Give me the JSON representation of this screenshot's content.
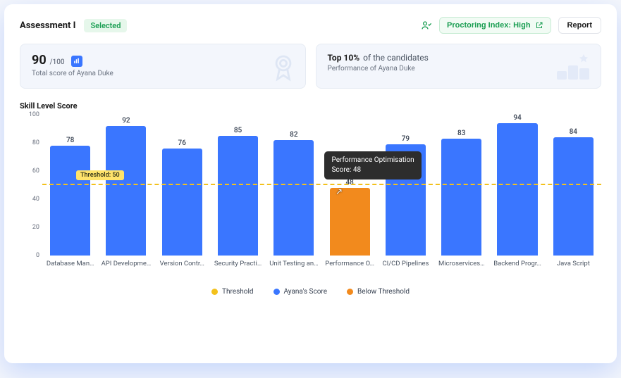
{
  "header": {
    "title": "Assessment I",
    "selected_badge": "Selected",
    "proctoring_label": "Proctoring Index: High",
    "report_label": "Report"
  },
  "stats": {
    "score": {
      "value": "90",
      "max": "/100",
      "caption": "Total score of Ayana Duke"
    },
    "rank": {
      "strong": "Top 10%",
      "rest": " of the candidates",
      "caption": "Performance of Ayana Duke"
    }
  },
  "chart_title": "Skill Level Score",
  "legend": {
    "threshold": "Threshold",
    "score": "Ayana's Score",
    "below": "Below Threshold"
  },
  "colors": {
    "bar": "#3a76ff",
    "below": "#f28a1d",
    "threshold": "#f3c11b"
  },
  "tooltip": {
    "line1": "Performance Optimisation",
    "line2": "Score: 48"
  },
  "threshold_label": "Threshold: 50",
  "chart_data": {
    "type": "bar",
    "title": "Skill Level Score",
    "xlabel": "",
    "ylabel": "",
    "ylim": [
      0,
      100
    ],
    "yticks": [
      0,
      20,
      40,
      60,
      80,
      100
    ],
    "threshold": 50,
    "categories_full": [
      "Database Management",
      "API Development",
      "Version Control",
      "Security Practices",
      "Unit Testing and QA",
      "Performance Optimisation",
      "CI/CD Pipelines",
      "Microservices",
      "Backend Programming",
      "Java Script"
    ],
    "categories_display": [
      "Database Man…",
      "API Developme…",
      "Version Contr…",
      "Security Practi…",
      "Unit Testing an…",
      "Performance O…",
      "CI/CD Pipelines",
      "Microservices…",
      "Backend Progr…",
      "Java Script"
    ],
    "values": [
      78,
      92,
      76,
      85,
      82,
      48,
      79,
      83,
      94,
      84
    ],
    "below_threshold_flags": [
      false,
      false,
      false,
      false,
      false,
      true,
      false,
      false,
      false,
      false
    ],
    "highlight_index": 5,
    "legend": [
      "Threshold",
      "Ayana's Score",
      "Below Threshold"
    ]
  }
}
